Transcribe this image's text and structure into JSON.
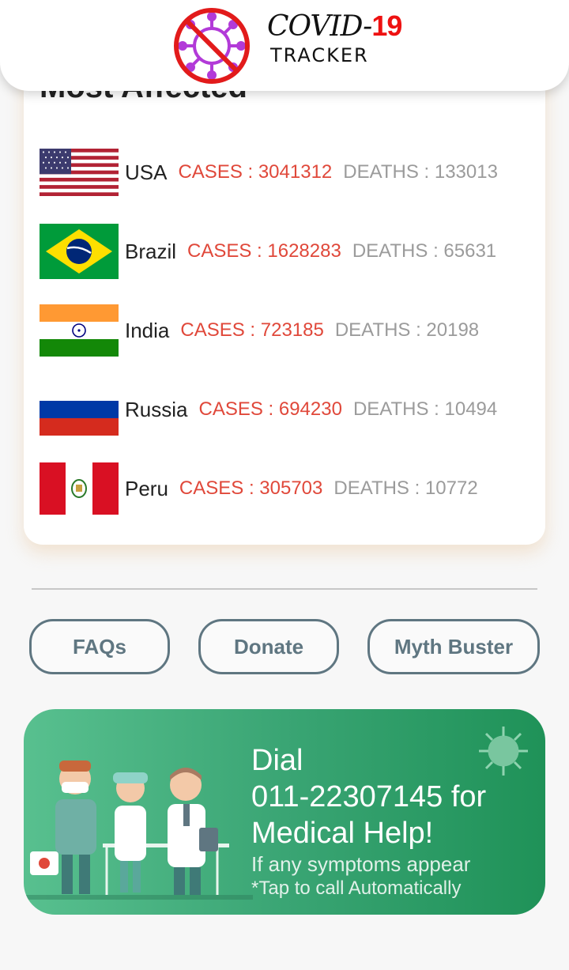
{
  "header": {
    "title_prefix": "COVID-",
    "title_number": "19",
    "subtitle": "TRACKER"
  },
  "most_affected": {
    "title": "Most Affected",
    "rows": [
      {
        "country": "USA",
        "cases": "CASES : 3041312",
        "deaths": "DEATHS : 133013",
        "flag": "usa-flag-icon"
      },
      {
        "country": "Brazil",
        "cases": "CASES : 1628283",
        "deaths": "DEATHS : 65631",
        "flag": "brazil-flag-icon"
      },
      {
        "country": "India",
        "cases": "CASES : 723185",
        "deaths": "DEATHS : 20198",
        "flag": "india-flag-icon"
      },
      {
        "country": "Russia",
        "cases": "CASES : 694230",
        "deaths": "DEATHS : 10494",
        "flag": "russia-flag-icon"
      },
      {
        "country": "Peru",
        "cases": "CASES : 305703",
        "deaths": "DEATHS : 10772",
        "flag": "peru-flag-icon"
      }
    ]
  },
  "buttons": {
    "faqs": "FAQs",
    "donate": "Donate",
    "myth_buster": "Myth Buster"
  },
  "banner": {
    "line1": "Dial",
    "line2": "011-22307145 for",
    "line3": "Medical Help!",
    "line4": "If any symptoms appear",
    "line5": "*Tap to call Automatically"
  },
  "colors": {
    "cases": "#e0483a",
    "deaths": "#9b9b9b",
    "button": "#5f7681",
    "banner_start": "#58c08f",
    "banner_end": "#1f9258"
  }
}
